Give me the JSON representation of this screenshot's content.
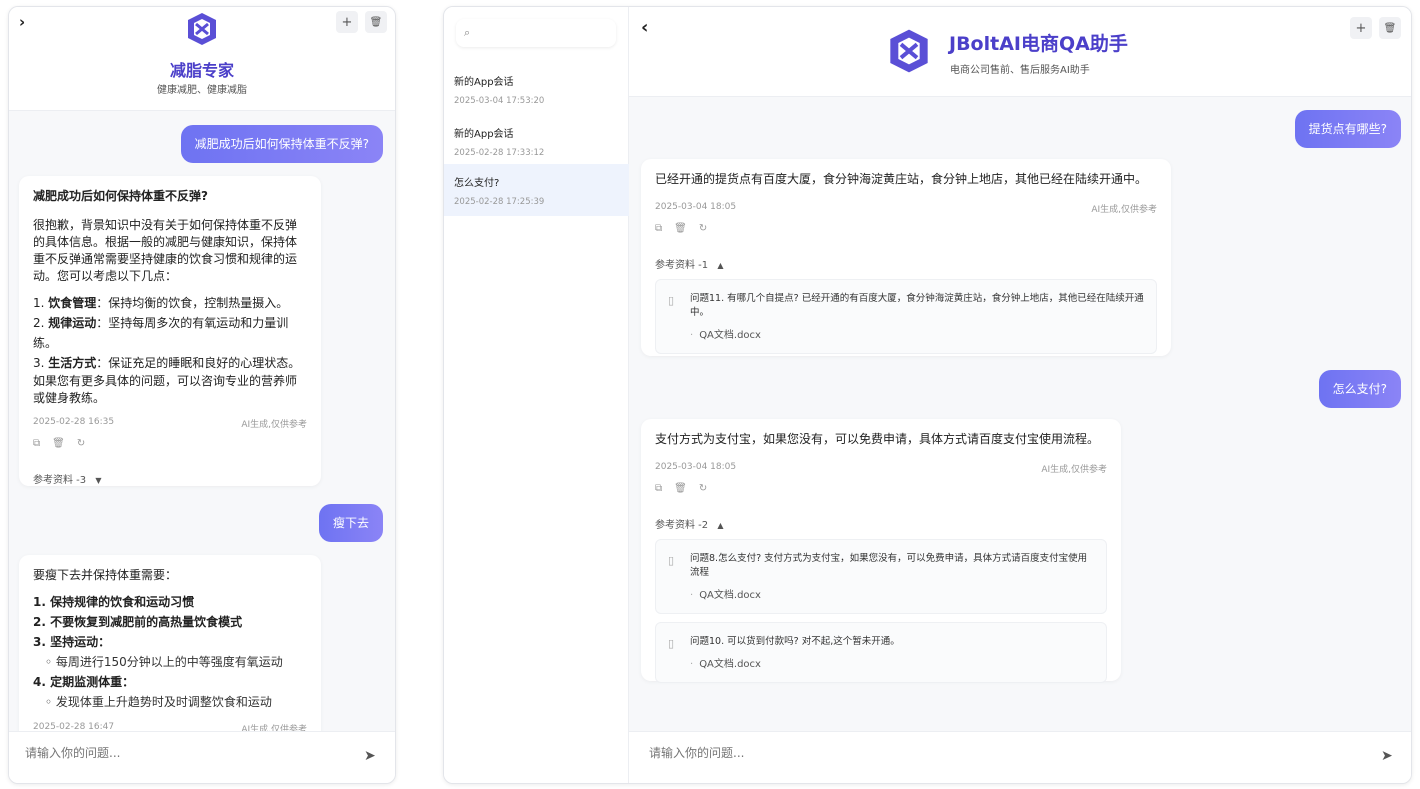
{
  "left": {
    "header": {
      "expand_icon": "›",
      "new_icon": "+",
      "delete_icon": "🗑",
      "title": "减脂专家",
      "subtitle": "健康减肥、健康减脂"
    },
    "user_messages": [
      "减肥成功后如何保持体重不反弹?",
      "瘦下去"
    ],
    "answer1": {
      "heading": "减肥成功后如何保持体重不反弹?",
      "intro": "很抱歉，背景知识中没有关于如何保持体重不反弹的具体信息。根据一般的减肥与健康知识，保持体重不反弹通常需要坚持健康的饮食习惯和规律的运动。您可以考虑以下几点：",
      "items": [
        {
          "num": "1.",
          "bold": "饮食管理",
          "text": "：保持均衡的饮食，控制热量摄入。"
        },
        {
          "num": "2.",
          "bold": "规律运动",
          "text": "：坚持每周多次的有氧运动和力量训练。"
        },
        {
          "num": "3.",
          "bold": "生活方式",
          "text": "：保证充足的睡眠和良好的心理状态。"
        }
      ],
      "outro": "如果您有更多具体的问题，可以咨询专业的营养师或健身教练。",
      "time": "2025-02-28 16:35",
      "note": "AI生成,仅供参考",
      "ref_label": "参考资料 -3"
    },
    "answer2": {
      "intro": "要瘦下去并保持体重需要：",
      "items": [
        {
          "text": "1. 保持规律的饮食和运动习惯",
          "sub": ""
        },
        {
          "text": "2. 不要恢复到减肥前的高热量饮食模式",
          "sub": ""
        },
        {
          "text": "3. 坚持运动：",
          "sub": "每周进行150分钟以上的中等强度有氧运动"
        },
        {
          "text": "4. 定期监测体重：",
          "sub": "发现体重上升趋势时及时调整饮食和运动"
        }
      ],
      "time": "2025-02-28 16:47",
      "note": "AI生成,仅供参考"
    },
    "input": {
      "placeholder": "请输入你的问题..."
    }
  },
  "right": {
    "search": {
      "placeholder": ""
    },
    "sessions": [
      {
        "title": "新的App会话",
        "date": "2025-03-04 17:53:20"
      },
      {
        "title": "新的App会话",
        "date": "2025-02-28 17:33:12"
      },
      {
        "title": "怎么支付?",
        "date": "2025-02-28 17:25:39"
      }
    ],
    "header": {
      "back_icon": "‹",
      "new_icon": "+",
      "delete_icon": "🗑",
      "title": "JBoltAI电商QA助手",
      "subtitle": "电商公司售前、售后服务AI助手"
    },
    "user_messages": [
      "提货点有哪些?",
      "怎么支付?"
    ],
    "answer1": {
      "text": "已经开通的提货点有百度大厦，食分钟海淀黄庄站，食分钟上地店，其他已经在陆续开通中。",
      "time": "2025-03-04 18:05",
      "note": "AI生成,仅供参考",
      "ref_label": "参考资料 -1",
      "refs": [
        {
          "q": "问题11. 有哪几个自提点? 已经开通的有百度大厦，食分钟海淀黄庄站，食分钟上地店，其他已经在陆续开通中。",
          "file": "QA文档.docx"
        }
      ]
    },
    "answer2": {
      "text": "支付方式为支付宝，如果您没有，可以免费申请，具体方式请百度支付宝使用流程。",
      "time": "2025-03-04 18:05",
      "note": "AI生成,仅供参考",
      "ref_label": "参考资料 -2",
      "refs": [
        {
          "q": "问题8.怎么支付? 支付方式为支付宝，如果您没有，可以免费申请，具体方式请百度支付宝使用流程",
          "file": "QA文档.docx"
        },
        {
          "q": "问题10. 可以货到付款吗? 对不起,这个暂未开通。",
          "file": "QA文档.docx"
        }
      ]
    },
    "input": {
      "placeholder": "请输入你的问题..."
    }
  }
}
